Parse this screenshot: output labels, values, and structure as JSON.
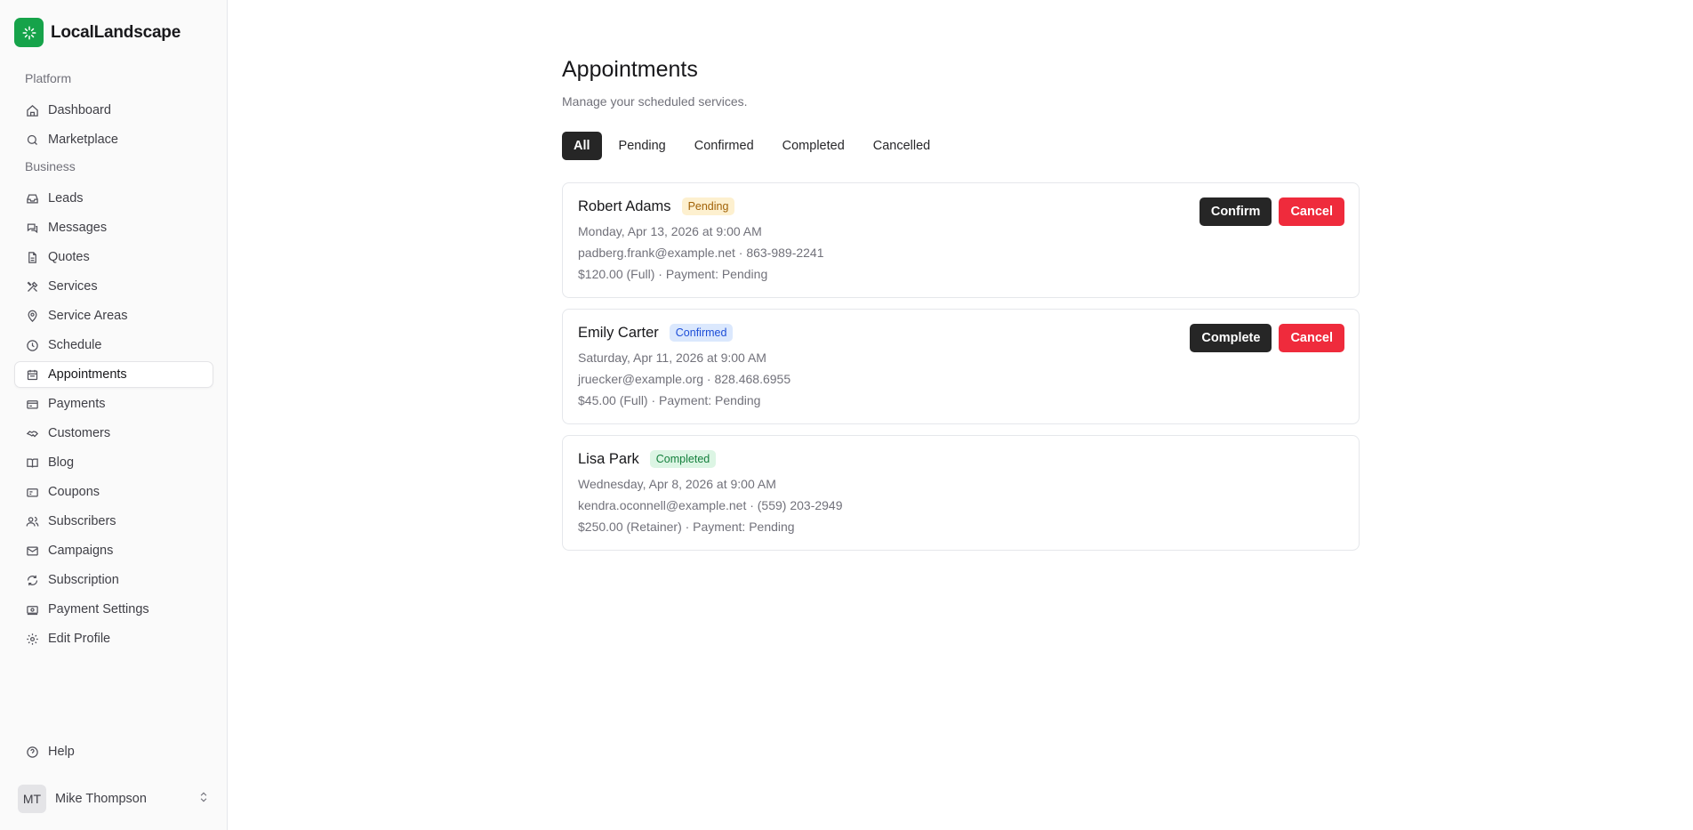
{
  "app": {
    "name": "LocalLandscape"
  },
  "sidebar": {
    "groups": [
      {
        "label": "Platform",
        "items": [
          {
            "label": "Dashboard",
            "icon": "home-icon"
          },
          {
            "label": "Marketplace",
            "icon": "search-icon"
          }
        ]
      },
      {
        "label": "Business",
        "items": [
          {
            "label": "Leads",
            "icon": "inbox-icon"
          },
          {
            "label": "Messages",
            "icon": "messages-icon"
          },
          {
            "label": "Quotes",
            "icon": "document-icon"
          },
          {
            "label": "Services",
            "icon": "tools-icon"
          },
          {
            "label": "Service Areas",
            "icon": "map-pin-icon"
          },
          {
            "label": "Schedule",
            "icon": "clock-icon"
          },
          {
            "label": "Appointments",
            "icon": "calendar-icon",
            "active": true
          },
          {
            "label": "Payments",
            "icon": "credit-card-icon"
          },
          {
            "label": "Customers",
            "icon": "handshake-icon"
          },
          {
            "label": "Blog",
            "icon": "book-icon"
          },
          {
            "label": "Coupons",
            "icon": "ticket-icon"
          },
          {
            "label": "Subscribers",
            "icon": "users-icon"
          },
          {
            "label": "Campaigns",
            "icon": "mail-icon"
          },
          {
            "label": "Subscription",
            "icon": "refresh-icon"
          },
          {
            "label": "Payment Settings",
            "icon": "banknote-icon"
          },
          {
            "label": "Edit Profile",
            "icon": "gear-icon"
          }
        ]
      }
    ],
    "help": {
      "label": "Help",
      "icon": "help-circle-icon"
    },
    "user": {
      "initials": "MT",
      "name": "Mike Thompson"
    }
  },
  "page": {
    "title": "Appointments",
    "subtitle": "Manage your scheduled services.",
    "tabs": [
      {
        "label": "All",
        "active": true
      },
      {
        "label": "Pending"
      },
      {
        "label": "Confirmed"
      },
      {
        "label": "Completed"
      },
      {
        "label": "Cancelled"
      }
    ]
  },
  "appointments": [
    {
      "name": "Robert Adams",
      "status": "Pending",
      "datetime": "Monday, Apr 13, 2026 at 9:00 AM",
      "contact": "padberg.frank@example.net · 863-989-2241",
      "payment": "$120.00 (Full) · Payment: Pending",
      "primary_action": "Confirm",
      "secondary_action": "Cancel"
    },
    {
      "name": "Emily Carter",
      "status": "Confirmed",
      "datetime": "Saturday, Apr 11, 2026 at 9:00 AM",
      "contact": "jruecker@example.org · 828.468.6955",
      "payment": "$45.00 (Full) · Payment: Pending",
      "primary_action": "Complete",
      "secondary_action": "Cancel"
    },
    {
      "name": "Lisa Park",
      "status": "Completed",
      "datetime": "Wednesday, Apr 8, 2026 at 9:00 AM",
      "contact": "kendra.oconnell@example.net · (559) 203-2949",
      "payment": "$250.00 (Retainer) · Payment: Pending"
    }
  ],
  "colors": {
    "brand": "#16a34a",
    "dark_button": "#262626",
    "danger": "#ef2b3c",
    "pending_badge": "#fdf0cf",
    "confirmed_badge": "#dbe8fd",
    "completed_badge": "#dcf5e4"
  }
}
